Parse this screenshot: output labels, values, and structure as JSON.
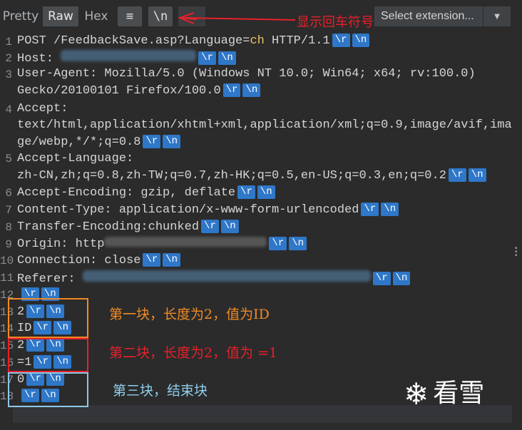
{
  "toolbar": {
    "pretty": "Pretty",
    "raw": "Raw",
    "hex": "Hex",
    "wrap_icon": "≡",
    "newline_toggle": "\\n",
    "select_ext": "Select extension...",
    "caret": "▼"
  },
  "annotations": {
    "top": "显示回车符号",
    "block1": "第一块，长度为2，值为ID",
    "block2": "第二块，长度为2，值为 =1",
    "block3": "第三块，结束块"
  },
  "request": {
    "l1": "POST /FeedbackSave.asp?Language=",
    "l1b": "ch",
    "l1c": " HTTP/1.1",
    "l2": "Host: ",
    "l3a": "User-Agent: Mozilla/5.0 (Windows NT 10.0; Win64; x64; rv:100.0)",
    "l3b": "Gecko/20100101 Firefox/100.0",
    "l4a": "Accept:",
    "l4b": "text/html,application/xhtml+xml,application/xml;q=0.9,image/avif,ima",
    "l4c": "ge/webp,*/*;q=0.8",
    "l5a": "Accept-Language:",
    "l5b": "zh-CN,zh;q=0.8,zh-TW;q=0.7,zh-HK;q=0.5,en-US;q=0.3,en;q=0.2",
    "l6": "Accept-Encoding: gzip, deflate",
    "l7": "Content-Type: application/x-www-form-urlencoded",
    "l8": "Transfer-Encoding:chunked",
    "l9": "Origin: http",
    "l10": "Connection: close",
    "l11": "Referer: ",
    "l13": "2",
    "l14": "ID",
    "l15": "2",
    "l16": "=1",
    "l17": "0"
  },
  "tags": {
    "cr": "\\r",
    "lf": "\\n"
  },
  "line_numbers": [
    "1",
    "2",
    "3",
    "4",
    "5",
    "6",
    "7",
    "8",
    "9",
    "10",
    "11",
    "12",
    "13",
    "14",
    "15",
    "16",
    "17",
    "18"
  ],
  "logo": {
    "icon": "❄",
    "text": "看雪"
  }
}
